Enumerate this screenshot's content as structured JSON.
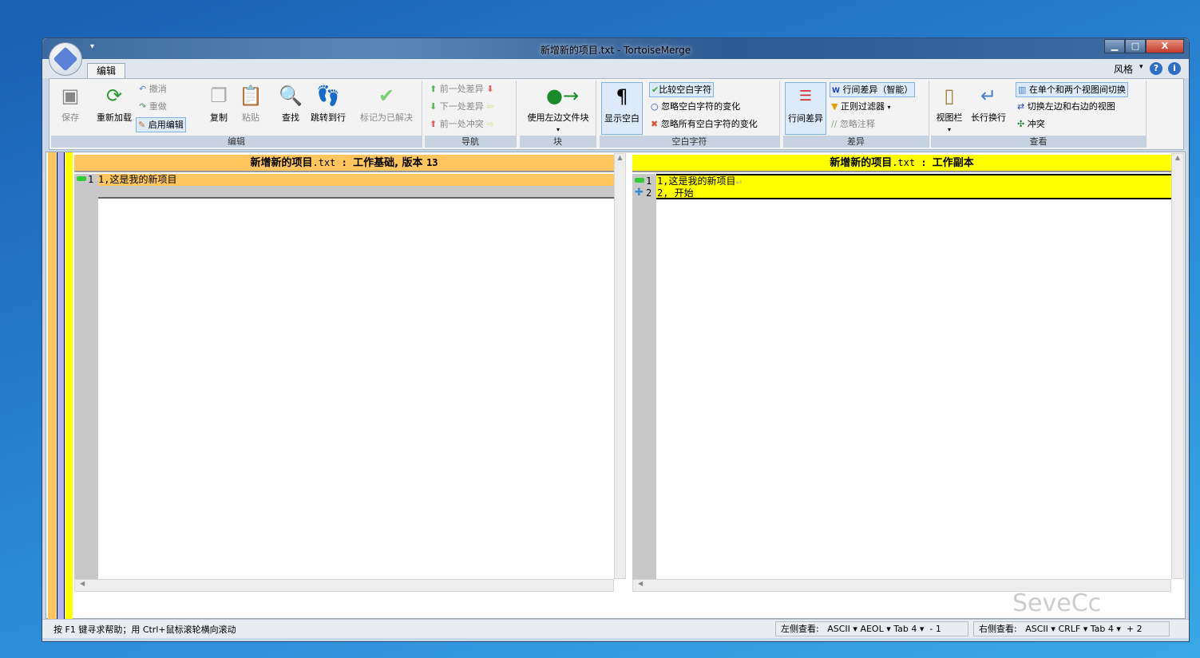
{
  "window": {
    "title": "新增新的项目.txt - TortoiseMerge",
    "min": "▁",
    "max": "□",
    "close": "X",
    "qat_arrow": "▾"
  },
  "tabs": [
    {
      "label": "编辑"
    }
  ],
  "top_right": {
    "style_label": "风格",
    "style_arrow": "▾",
    "help": "?",
    "info": "i"
  },
  "ribbon": {
    "groups": [
      {
        "label": "编辑"
      },
      {
        "label": "导航"
      },
      {
        "label": "块"
      },
      {
        "label": "空白字符"
      },
      {
        "label": "差异"
      },
      {
        "label": "查看"
      }
    ],
    "edit": {
      "save": "保存",
      "reload": "重新加载",
      "undo": "撤消",
      "redo": "重做",
      "enable_edit": "启用编辑",
      "copy": "复制",
      "paste": "粘贴",
      "find": "查找",
      "goto_line": "跳转到行",
      "mark_resolved": "标记为已解决"
    },
    "nav": {
      "prev_diff": "前一处差异",
      "next_diff": "下一处差异",
      "prev_conflict": "前一处冲突"
    },
    "block": {
      "use_left_block": "使用左边文件块",
      "arrow": "▾"
    },
    "whitespace": {
      "show_ws": "显示空白",
      "compare_ws": "比较空白字符",
      "ignore_ws_change": "忽略空白字符的变化",
      "ignore_all_ws": "忽略所有空白字符的变化"
    },
    "diff": {
      "inline_diff": "行间差异",
      "inline_smart": "行间差异（智能）",
      "regex_filter": "正则过滤器",
      "ignore_comments": "忽略注释"
    },
    "view": {
      "view_bar": "视图栏",
      "wrap_long": "长行换行",
      "toggle_one_two": "在单个和两个视图间切换",
      "swap_views": "切换左边和右边的视图",
      "conflicts": "冲突"
    }
  },
  "left_pane": {
    "header_name": "新增新的项目",
    "header_ext": ".txt",
    "header_sep": " : ",
    "header_desc": "工作基础, 版本",
    "header_rev": "13",
    "lines": [
      {
        "num": "1",
        "text": "1,这是我的新项目"
      }
    ]
  },
  "right_pane": {
    "header_name": "新增新的项目",
    "header_ext": ".txt",
    "header_sep": " : ",
    "header_desc": "工作副本",
    "lines": [
      {
        "num": "1",
        "text": "1,这是我的新项目",
        "eol": "↵"
      },
      {
        "num": "2",
        "text": "2, 开始"
      }
    ]
  },
  "status": {
    "help": "按 F1 键寻求帮助；用 Ctrl+鼠标滚轮横向滚动",
    "left": {
      "label": "左侧查看:",
      "encoding": "ASCII",
      "eol": "AEOL",
      "tab": "Tab 4",
      "count": "- 1"
    },
    "right": {
      "label": "右侧查看:",
      "encoding": "ASCII",
      "eol": "CRLF",
      "tab": "Tab 4",
      "count": "+ 2"
    },
    "arrow": "▾"
  },
  "watermark": "SeveCc",
  "colors": {
    "left_header": "#ffc660",
    "right_header": "#ffff00",
    "gutter": "#c8c8c8",
    "lavender": "#b4b4f0"
  }
}
